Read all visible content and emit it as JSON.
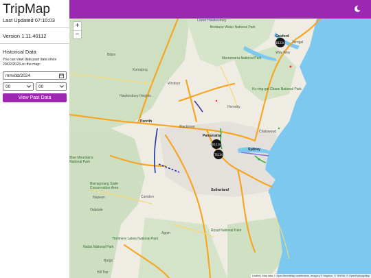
{
  "sidebar": {
    "title": "TripMap",
    "last_updated": "Last Updated 07:10:03",
    "version": "Version 1.11.40112",
    "historical": {
      "heading": "Historical Data",
      "description": "You can view data past data since 29/02/2024 on the map:",
      "date_placeholder": "mm/dd/2024",
      "hour_value": "00",
      "minute_value": "00",
      "button_label": "View Past Data"
    }
  },
  "topbar": {
    "theme_icon": "moon-icon",
    "color": "#9c27b0"
  },
  "map": {
    "zoom_in": "+",
    "zoom_out": "−",
    "attribution": "Leaflet | Map data © OpenStreetMap contributors, Imagery © Mapbox, © TfNSW, © OpenRailwayMap",
    "labels": {
      "gosford": "Gosford",
      "woy_woy": "Woy Woy",
      "terrigal": "Terrigal",
      "lower_hawkesbury": "Lower Hawkesbury",
      "brisbane_water": "Brisbane Water National Park",
      "marramarra": "Marramarra National Park",
      "kuring_gai": "Ku-ring-gai Chase National Park",
      "bilpin": "Bilpin",
      "kurrajong": "Kurrajong",
      "windsor": "Windsor",
      "hawkesbury": "Hawkesbury Heights",
      "hornsby": "Hornsby",
      "penrith": "Penrith",
      "blacktown": "Blacktown",
      "parramatta": "Parramatta",
      "chatswood": "Chatswood",
      "sydney": "Sydney",
      "blue_mountains": "Blue Mountains National Park",
      "burragorang": "Burragorang State Conservation Area",
      "camden": "Camden",
      "sutherland": "Sutherland",
      "royal": "Royal National Park",
      "appin": "Appin",
      "nattai": "Nattai National Park",
      "thirlmere": "Thirlmere Lakes National Park",
      "bargo": "Bargo",
      "hill_top": "Hill Top",
      "nepean": "Nepean",
      "oakdale": "Oakdale"
    },
    "markers": [
      {
        "id": "marker-1",
        "label": "D1234"
      },
      {
        "id": "marker-2",
        "label": "D1234"
      },
      {
        "id": "marker-3",
        "label": "T6134"
      }
    ]
  }
}
